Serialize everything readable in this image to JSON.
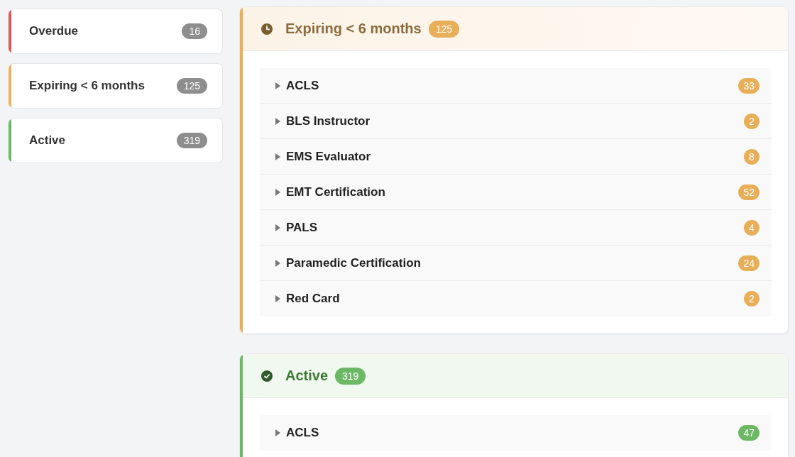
{
  "sidebar": {
    "items": [
      {
        "label": "Overdue",
        "count": "16",
        "color": "#d65a5a"
      },
      {
        "label": "Expiring < 6 months",
        "count": "125",
        "color": "#e8b060"
      },
      {
        "label": "Active",
        "count": "319",
        "color": "#6cb865"
      }
    ]
  },
  "sections": [
    {
      "kind": "expiring",
      "title": "Expiring < 6 months",
      "count": "125",
      "color": "#e8ae58",
      "rows": [
        {
          "label": "ACLS",
          "count": "33",
          "expanded": false
        },
        {
          "label": "BLS Instructor",
          "count": "2",
          "expanded": false
        },
        {
          "label": "EMS Evaluator",
          "count": "8",
          "expanded": false
        },
        {
          "label": "EMT Certification",
          "count": "52",
          "expanded": false
        },
        {
          "label": "PALS",
          "count": "4",
          "expanded": false
        },
        {
          "label": "Paramedic Certification",
          "count": "24",
          "expanded": false
        },
        {
          "label": "Red Card",
          "count": "2",
          "expanded": false
        }
      ]
    },
    {
      "kind": "active",
      "title": "Active",
      "count": "319",
      "color": "#6cb865",
      "rows": [
        {
          "label": "ACLS",
          "count": "47",
          "expanded": false
        }
      ]
    }
  ]
}
